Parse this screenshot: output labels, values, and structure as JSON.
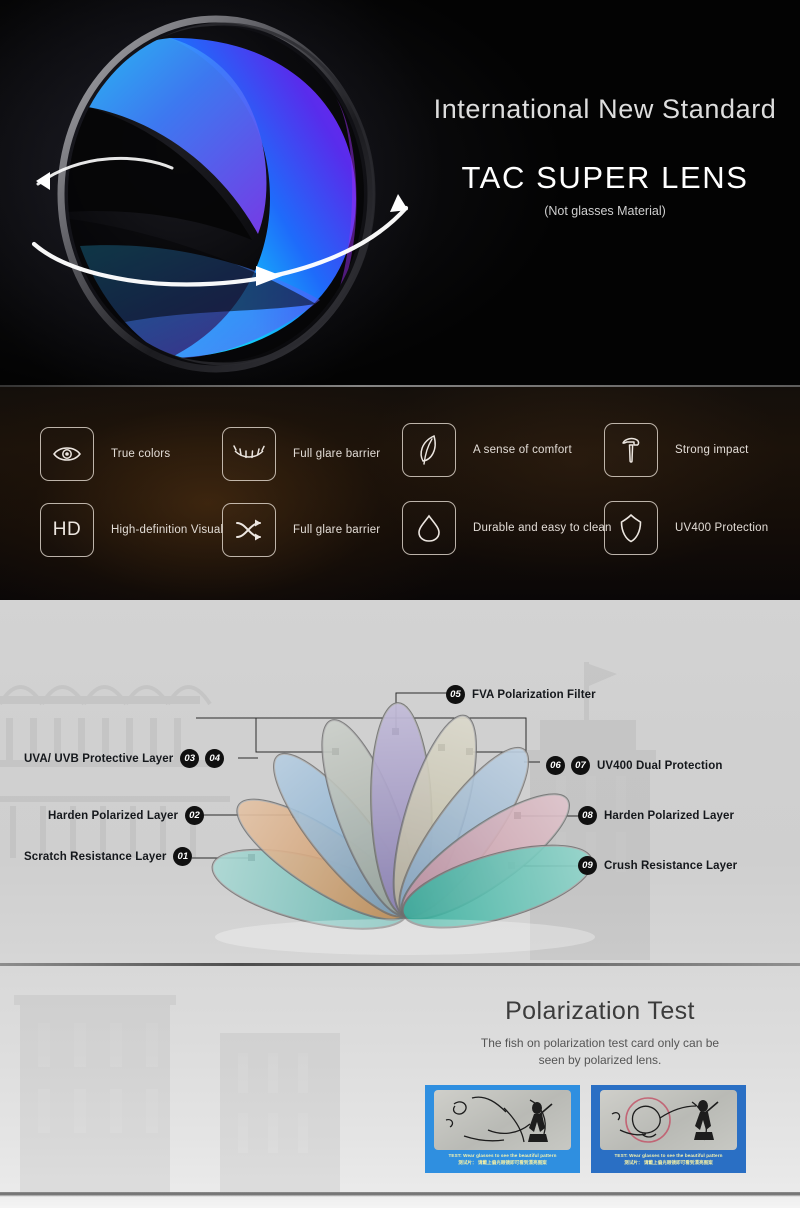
{
  "hero": {
    "eyebrow": "International New Standard",
    "title": "TAC SUPER LENS",
    "subtitle": "(Not glasses Material)",
    "lens_icon": "lens-sphere-icon",
    "colors": {
      "cyan": "#12d4ff",
      "blue": "#1464ff",
      "violet": "#7a20f5"
    }
  },
  "features": {
    "items": [
      {
        "icon": "eye-icon",
        "label": "True colors"
      },
      {
        "icon": "eyelash-icon",
        "label": "Full glare barrier"
      },
      {
        "icon": "feather-icon",
        "label": "A sense of comfort"
      },
      {
        "icon": "hammer-icon",
        "label": "Strong impact"
      },
      {
        "icon": "hd-icon",
        "label": "High-definition Visual",
        "text": "HD"
      },
      {
        "icon": "shuffle-icon",
        "label": "Full glare barrier"
      },
      {
        "icon": "droplet-icon",
        "label": "Durable and easy to clean"
      },
      {
        "icon": "shield-icon",
        "label": "UV400 Protection"
      }
    ]
  },
  "diagram": {
    "labels_left": [
      {
        "text": "UVA/ UVB Protective Layer",
        "badges": [
          "03",
          "04"
        ]
      },
      {
        "text": "Harden Polarized Layer",
        "badges": [
          "02"
        ]
      },
      {
        "text": "Scratch Resistance Layer",
        "badges": [
          "01"
        ]
      }
    ],
    "label_top": {
      "text": "FVA Polarization Filter",
      "badges": [
        "05"
      ]
    },
    "labels_right": [
      {
        "text": "UV400 Dual Protection",
        "badges": [
          "06",
          "07"
        ]
      },
      {
        "text": "Harden Polarized Layer",
        "badges": [
          "08"
        ]
      },
      {
        "text": "Crush Resistance Layer",
        "badges": [
          "09"
        ]
      }
    ],
    "petal_colors": [
      "#59b3ab",
      "#c98a52",
      "#6f9ec4",
      "#9aa398",
      "#8b7fb5",
      "#b9b49a",
      "#7ea2c4",
      "#c18d9c",
      "#2fae9b"
    ]
  },
  "polarization_test": {
    "title": "Polarization Test",
    "subtitle_line1": "The fish on polarization test card only can be",
    "subtitle_line2": "seen by polarized lens.",
    "cards": [
      {
        "name": "unpolarized-card",
        "caption_en": "TEST: Wear glasses to see the beautiful pattern",
        "caption_cn": "测试片： 请戴上偏光眼镜即可看到漂亮图案",
        "bg": "#2f8fe0"
      },
      {
        "name": "polarized-card",
        "caption_en": "TEST: Wear glasses to see the beautiful pattern",
        "caption_cn": "测试片： 请戴上偏光眼镜即可看到漂亮图案",
        "bg": "#2a6fc4"
      }
    ]
  }
}
